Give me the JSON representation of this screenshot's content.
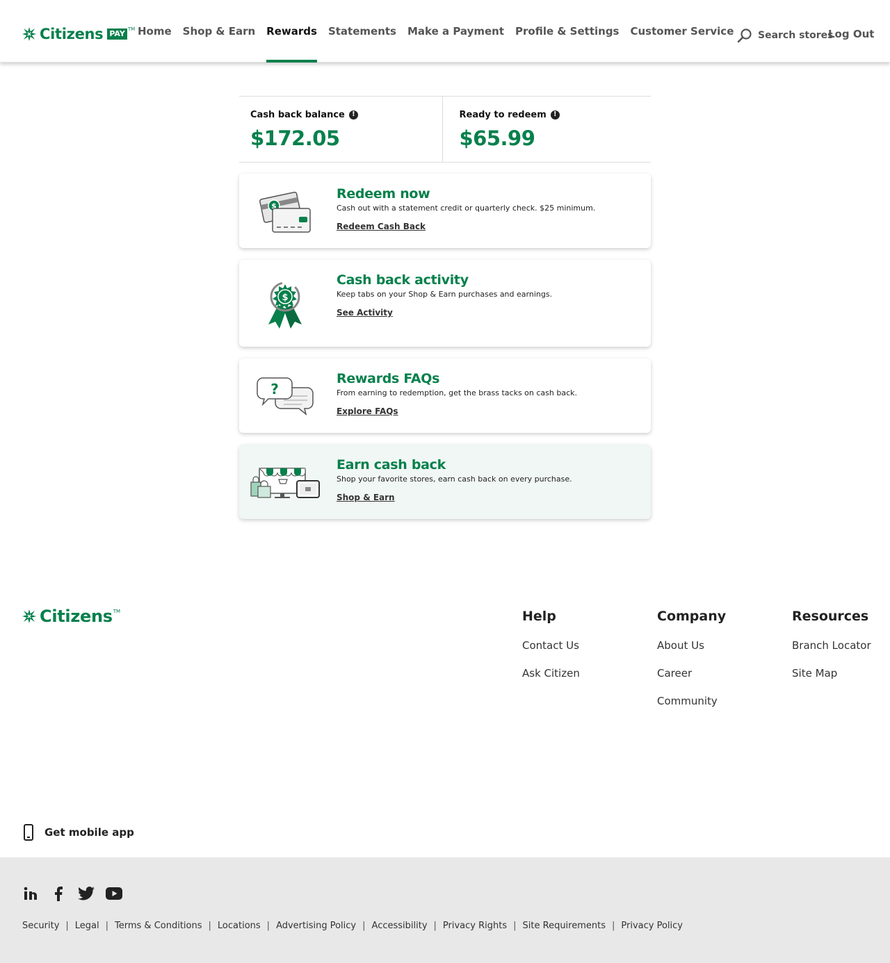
{
  "header": {
    "logo_text": "Citizens",
    "logo_badge": "PAY",
    "logo_tm": "TM",
    "nav": [
      {
        "label": "Home"
      },
      {
        "label": "Shop & Earn"
      },
      {
        "label": "Rewards"
      },
      {
        "label": "Statements"
      },
      {
        "label": "Make a Payment"
      },
      {
        "label": "Profile & Settings"
      },
      {
        "label": "Customer Service"
      }
    ],
    "active_nav": "Rewards",
    "search_label": "Search stores",
    "logout_label": "Log Out"
  },
  "balances": [
    {
      "label": "Cash back balance",
      "value": "$172.05"
    },
    {
      "label": "Ready to redeem",
      "value": "$65.99"
    }
  ],
  "cards": [
    {
      "title": "Redeem now",
      "description": "Cash out with a statement credit or quarterly check. $25 minimum.",
      "link": "Redeem Cash Back",
      "icon": "credit-cards-illustration"
    },
    {
      "title": "Cash back activity",
      "description": "Keep tabs on your Shop & Earn purchases and earnings.",
      "link": "See Activity",
      "icon": "award-ribbon-illustration"
    },
    {
      "title": "Rewards FAQs",
      "description": "From earning to redemption, get the brass tacks on cash back.",
      "link": "Explore FAQs",
      "icon": "chat-bubbles-illustration"
    },
    {
      "title": "Earn cash back",
      "description": "Shop your favorite stores, earn cash back on every purchase.",
      "link": "Shop & Earn",
      "icon": "storefront-devices-illustration"
    }
  ],
  "footer": {
    "logo_text": "Citizens",
    "logo_tm": "TM",
    "columns": [
      {
        "heading": "Help",
        "links": [
          "Contact Us",
          "Ask Citizen"
        ]
      },
      {
        "heading": "Company",
        "links": [
          "About Us",
          "Career",
          "Community"
        ]
      },
      {
        "heading": "Resources",
        "links": [
          "Branch Locator",
          "Site Map"
        ]
      }
    ],
    "mobile_app": "Get mobile app",
    "socials": [
      "linkedin-icon",
      "facebook-icon",
      "twitter-icon",
      "youtube-icon"
    ],
    "legal": [
      "Security",
      "Legal",
      "Terms & Conditions",
      "Locations",
      "Advertising Policy",
      "Accessibility",
      "Privacy Rights",
      "Site Requirements",
      "Privacy Policy"
    ]
  },
  "colors": {
    "brand_green": "#07804c",
    "footer_bg": "#e8e8e8",
    "card_tint": "#f0f7f4"
  }
}
